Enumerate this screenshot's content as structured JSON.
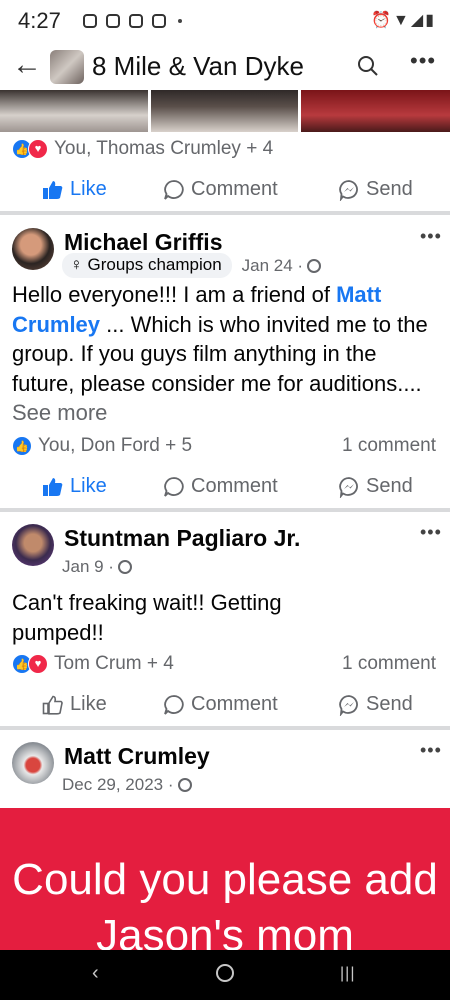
{
  "status_bar": {
    "time": "4:27"
  },
  "app_bar": {
    "title": "8 Mile & Van Dyke"
  },
  "posts": [
    {
      "reactions_text": "You, Thomas Crumley + 4",
      "actions": {
        "like": "Like",
        "comment": "Comment",
        "send": "Send"
      }
    },
    {
      "author": "Michael Griffis",
      "badge": "Groups champion",
      "date": "Jan 24 ·",
      "text_before": "Hello everyone!!! I am a friend of ",
      "mention": "Matt Crumley",
      "text_after": " ... Which is who invited me to the group. If you guys film anything in the future, please consider me for auditions.... ",
      "see_more": "See more",
      "reactions_text": "You, Don Ford + 5",
      "comments": "1 comment",
      "actions": {
        "like": "Like",
        "comment": "Comment",
        "send": "Send"
      }
    },
    {
      "author": "Stuntman Pagliaro Jr.",
      "date": "Jan 9 ·",
      "text": "Can't freaking wait!! Getting pumped!!",
      "reactions_text": "Tom Crum + 4",
      "comments": "1 comment",
      "actions": {
        "like": "Like",
        "comment": "Comment",
        "send": "Send"
      }
    },
    {
      "author": "Matt Crumley",
      "date": "Dec 29, 2023 ·",
      "banner_text": "Could you please add Jason's mom"
    }
  ],
  "colors": {
    "accent": "#1877f2",
    "love": "#f02849",
    "banner": "#e41e3f",
    "secondary_text": "#65676b"
  }
}
